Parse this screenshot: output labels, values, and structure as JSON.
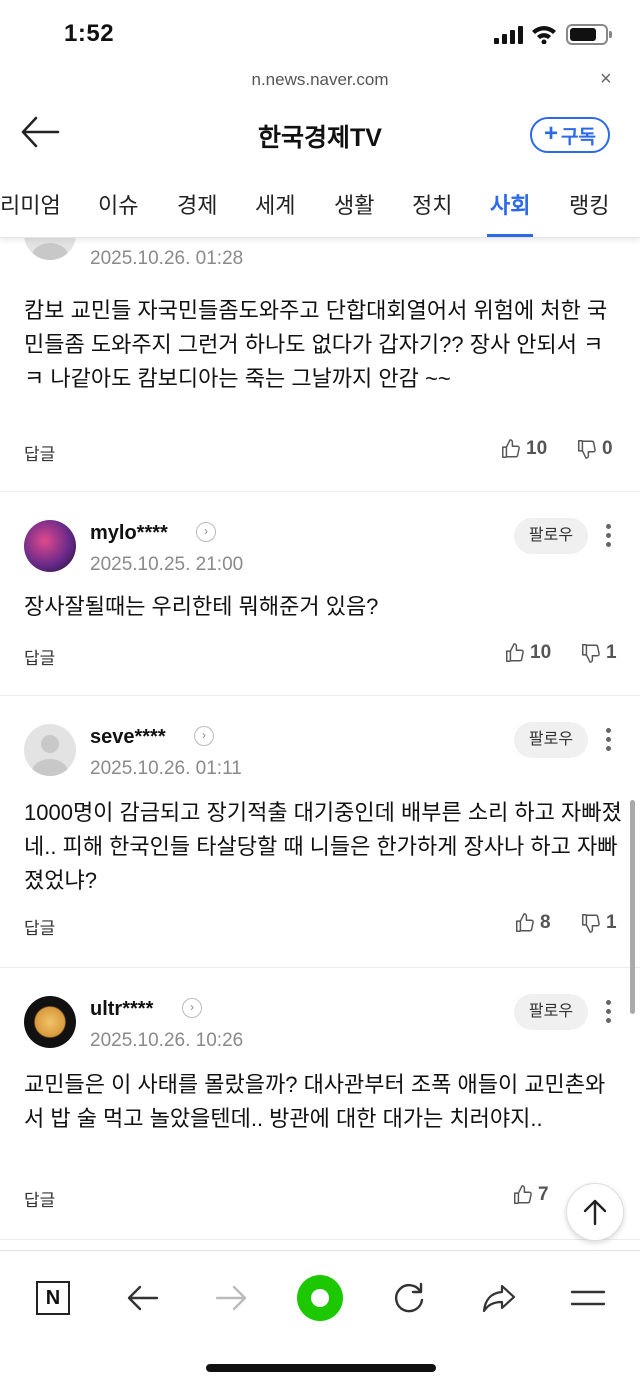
{
  "status_bar": {
    "time": "1:52"
  },
  "url_bar": {
    "url": "n.news.naver.com",
    "close_symbol": "×"
  },
  "header": {
    "title": "한국경제TV",
    "subscribe_label": "구독",
    "subscribe_symbol": "+"
  },
  "tabs": [
    {
      "label": "리미엄"
    },
    {
      "label": "이슈"
    },
    {
      "label": "경제"
    },
    {
      "label": "세계"
    },
    {
      "label": "생활"
    },
    {
      "label": "정치"
    },
    {
      "label": "사회",
      "active": true
    },
    {
      "label": "랭킹"
    }
  ],
  "comments": [
    {
      "author": "",
      "date": "2025.10.26. 01:28",
      "text": "캄보 교민들 자국민들좀도와주고 단합대회열어서 위험에 처한 국민들좀 도와주지 그런거 하나도 없다가 갑자기?? 장사 안되서 ㅋ ㅋ 나같아도 캄보디아는 죽는 그날까지 안감 ~~",
      "reply_label": "답글",
      "likes": "10",
      "dislikes": "0"
    },
    {
      "author": "mylo****",
      "date": "2025.10.25. 21:00",
      "text": "장사잘될때는 우리한테 뭐해준거 있음?",
      "reply_label": "답글",
      "follow_label": "팔로우",
      "likes": "10",
      "dislikes": "1"
    },
    {
      "author": "seve****",
      "date": "2025.10.26. 01:11",
      "text": "1000명이 감금되고 장기적출 대기중인데 배부른 소리 하고 자빠졌네.. 피해 한국인들 타살당할 때 니들은 한가하게 장사나 하고 자빠졌었냐?",
      "reply_label": "답글",
      "follow_label": "팔로우",
      "likes": "8",
      "dislikes": "1"
    },
    {
      "author": "ultr****",
      "date": "2025.10.26. 10:26",
      "text": "교민들은 이 사태를 몰랐을까? 대사관부터 조폭 애들이 교민촌와서 밥 술 먹고 놀았을텐데.. 방관에 대한 대가는 치러야지..",
      "reply_label": "답글",
      "follow_label": "팔로우",
      "likes": "7"
    }
  ],
  "bottom_bar": {
    "logo_letter": "N"
  },
  "colors": {
    "accent": "#2c69e8",
    "naver_green": "#1ec800"
  }
}
